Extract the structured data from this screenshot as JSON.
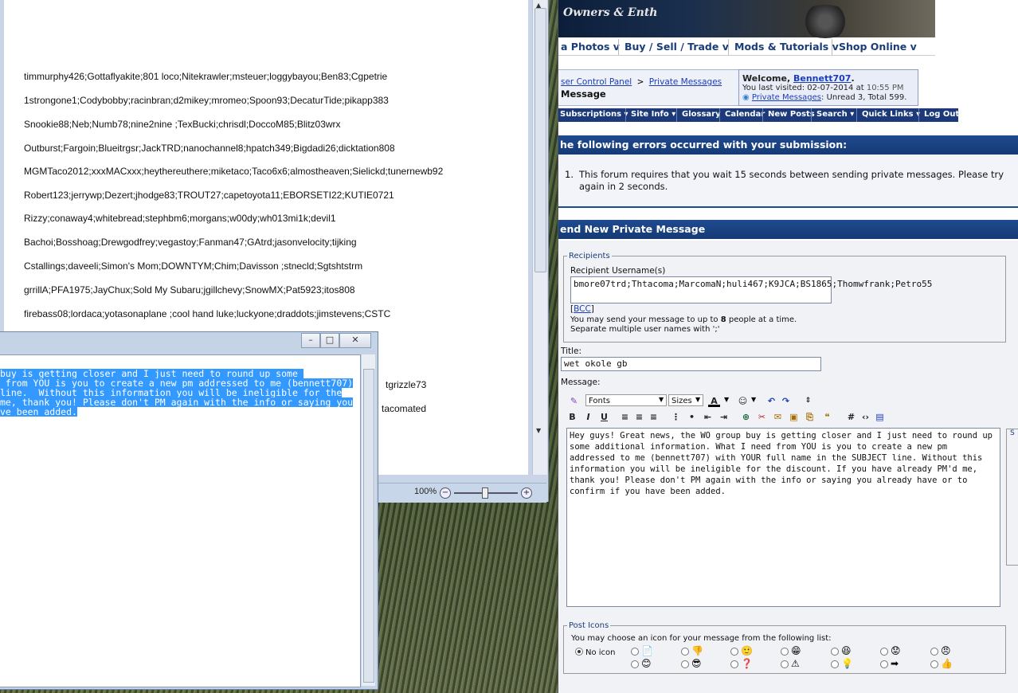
{
  "doc": {
    "lines": [
      "timmurphy426;Gottaflyakite;801 loco;Nitekrawler;msteuer;loggybayou;Ben83;Cgpetrie",
      "1strongone1;Codybobby;racinbran;d2mikey;mromeo;Spoon93;DecaturTide;pikapp383",
      "Snookie88;Neb;Numb78;nine2nine ;TexBucki;chrisdl;DoccoM85;Blitz03wrx",
      "Outburst;Fargoin;Blueitrgsr;JackTRD;nanochannel8;hpatch349;Bigdadi26;dicktation808",
      "MGMTaco2012;xxxMACxxx;heythereuthere;miketaco;Taco6x6;almostheaven;Sielickd;tunernewb92",
      "Robert123;jerrywp;Dezert;jhodge83;TROUT27;capetoyota11;EBORSETI22;KUTIE0721",
      "Rizzy;conaway4;whitebread;stephbm6;morgans;w00dy;wh013mi1k;devil1",
      "Bachoi;Bosshoag;Drewgodfrey;vegastoy;Fanman47;GAtrd;jasonvelocity;tijking",
      "Cstallings;daveeli;Simon's Mom;DOWNTYM;Chim;Davisson ;stnecld;Sgtshtstrm",
      "grrillA;PFA1975;JayChux;Sold My Subaru;jgillchevy;SnowMX;Pat5923;itos808",
      "firebass08;lordaca;yotasonaplane ;cool hand luke;luckyone;draddots;jimstevens;CSTC"
    ],
    "peek1": "tgrizzle73",
    "peek2": "tacomated",
    "zoom": "100%"
  },
  "notepad": {
    "lines": [
      "buy is getting closer and I just need to round up some ",
      " from YOU is you to create a new pm addressed to me (bennett707)",
      "line.  Without this information you will be ineligible for the",
      "me, thank you! Please don't PM again with the info or saying you",
      "ve been added."
    ]
  },
  "forum": {
    "banner_title": "Owners & Enth",
    "nav": [
      "a Photos v",
      "Buy / Sell / Trade v",
      "Mods & Tutorials v",
      "Shop Online v"
    ],
    "crumb_cp": "ser Control Panel",
    "crumb_sep": ">",
    "crumb_pm": "Private Messages",
    "crumb_title": "Message",
    "welcome_label": "Welcome,",
    "welcome_user": "Bennett707",
    "welcome_dot": ".",
    "last_visited": "You last visited: 02-07-2014 at",
    "last_time": "10:55 PM",
    "pm_link": "Private Messages",
    "pm_stats": ": Unread 3, Total 599.",
    "menu": [
      "Subscriptions ▾",
      "Site Info ▾",
      "Glossary",
      "Calendar",
      "New Posts",
      "Search ▾",
      "Quick Links ▾",
      "Log Out"
    ],
    "error_head": "he following errors occurred with your submission:",
    "error_num": "1.",
    "error_line1": "This forum requires that you wait 15 seconds between sending private messages. Please try",
    "error_line2": "again in 2 seconds.",
    "send_head": "end New Private Message",
    "recipients_legend": "Recipients",
    "recipient_label": "Recipient Username(s)",
    "recipient_value": "bmore07trd;Thtacoma;MarcomaN;huli467;K9JCA;BS1865;Thomwfrank;Petro55",
    "bcc": "BCC",
    "send_limit_pre": "You may send your message to up to ",
    "send_limit_num": "8",
    "send_limit_post": " people at a time.",
    "separate_note": "Separate multiple user names with ';'",
    "title_label": "Title:",
    "title_value": "wet okole gb",
    "message_label": "Message:",
    "fonts_label": "Fonts",
    "sizes_label": "Sizes",
    "message_body": "Hey guys!  Great news, the WO group buy is getting closer and I just need to round up some additional information.  What I need from YOU is you to create a new pm addressed to me (bennett707) with YOUR full name in the SUBJECT line.  Without this information you will be ineligible for the discount.  If you have already PM'd me, thank you! Please don't PM again with the info or saying you already have or to confirm if you have been added.",
    "post_icons_legend": "Post Icons",
    "post_icons_note": "You may choose an icon for your message from the following list:",
    "no_icon": "No icon",
    "right_stub": "S"
  }
}
